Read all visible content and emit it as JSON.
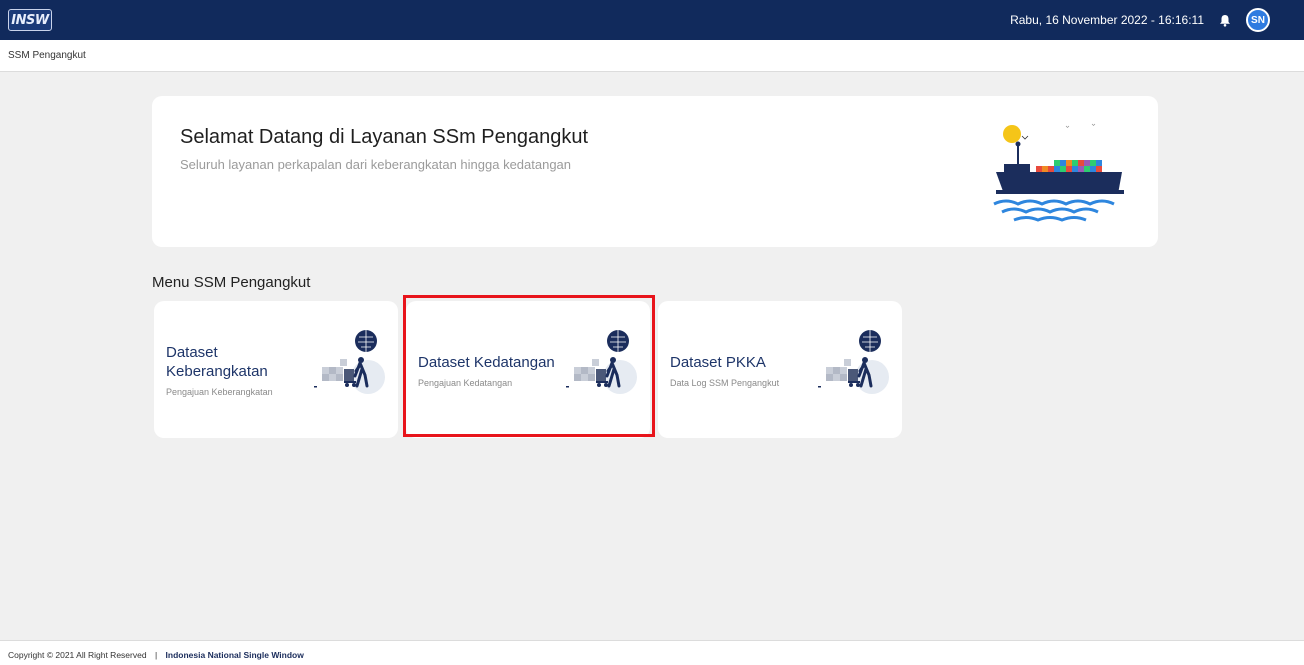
{
  "header": {
    "logo_text": "INSW",
    "datetime": "Rabu, 16 November 2022 - 16:16:11",
    "avatar_initials": "SN",
    "bg_color": "#112a5c",
    "icons": {
      "notification": "bell-icon"
    }
  },
  "breadcrumb": {
    "label": "SSM Pengangkut"
  },
  "hero": {
    "title": "Selamat Datang di Layanan SSm Pengangkut",
    "subtitle": "Seluruh layanan perkapalan dari keberangkatan hingga kedatangan",
    "illustration": "cargo-ship-illustration"
  },
  "menu": {
    "title": "Menu SSM Pengangkut",
    "cards": [
      {
        "title_line1": "Dataset",
        "title_line2": "Keberangkatan",
        "subtitle": "Pengajuan Keberangkatan",
        "illustration": "logistics-worker-illustration"
      },
      {
        "title_line1": "Dataset Kedatangan",
        "subtitle": "Pengajuan Kedatangan",
        "illustration": "logistics-worker-illustration",
        "highlighted": true
      },
      {
        "title_line1": "Dataset PKKA",
        "subtitle": "Data Log SSM Pengangkut",
        "illustration": "logistics-worker-illustration"
      }
    ],
    "highlight_color": "#e8141b"
  },
  "footer": {
    "copyright": "Copyright © 2021 All Right Reserved",
    "separator": "|",
    "brand": "Indonesia National Single Window"
  }
}
